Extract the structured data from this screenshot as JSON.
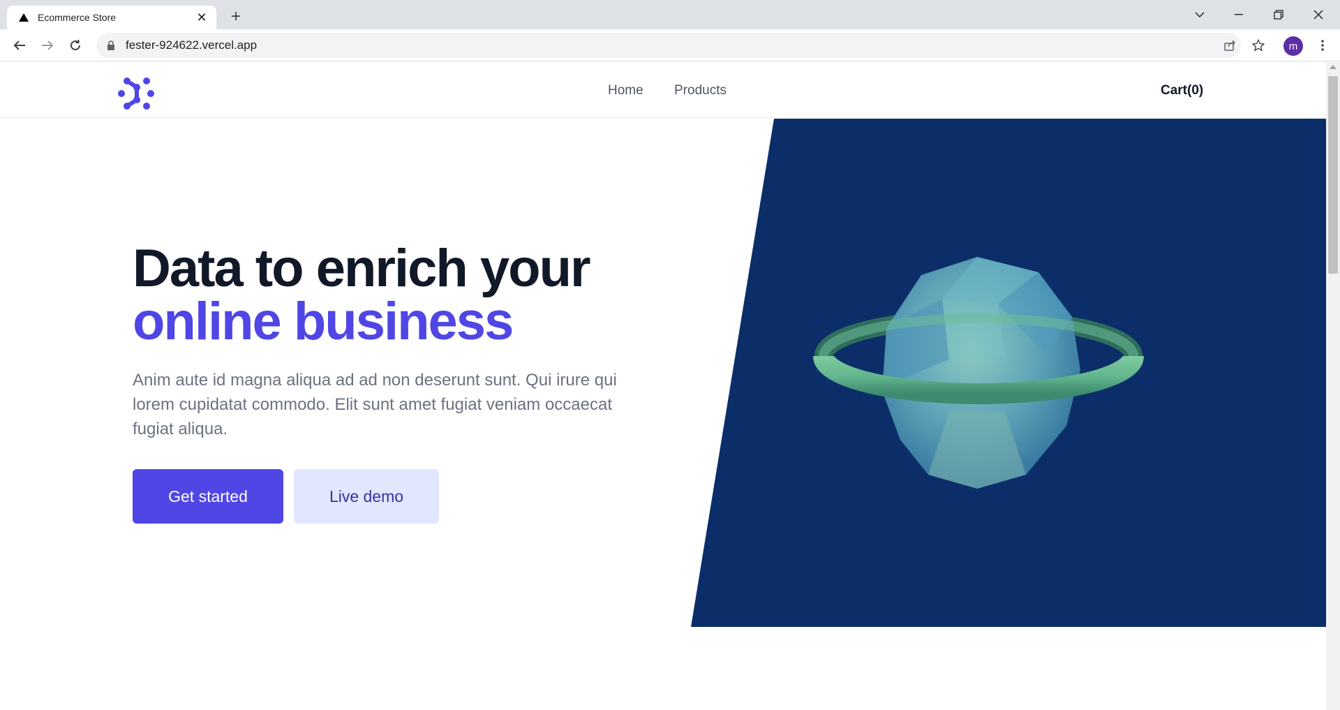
{
  "browser": {
    "tab_title": "Ecommerce Store",
    "url": "fester-924622.vercel.app",
    "profile_initial": "m"
  },
  "site": {
    "nav": [
      {
        "label": "Home"
      },
      {
        "label": "Products"
      }
    ],
    "cart_label": "Cart(0)"
  },
  "hero": {
    "title_line1": "Data to enrich your",
    "title_line2": "online business",
    "lead": "Anim aute id magna aliqua ad ad non deserunt sunt. Qui irure qui lorem cupidatat commodo. Elit sunt amet fugiat veniam occaecat fugiat aliqua.",
    "primary_cta": "Get started",
    "secondary_cta": "Live demo"
  },
  "colors": {
    "accent": "#4f46e5",
    "hero_panel": "#0b2e69",
    "secondary_bg": "#e0e7ff"
  }
}
